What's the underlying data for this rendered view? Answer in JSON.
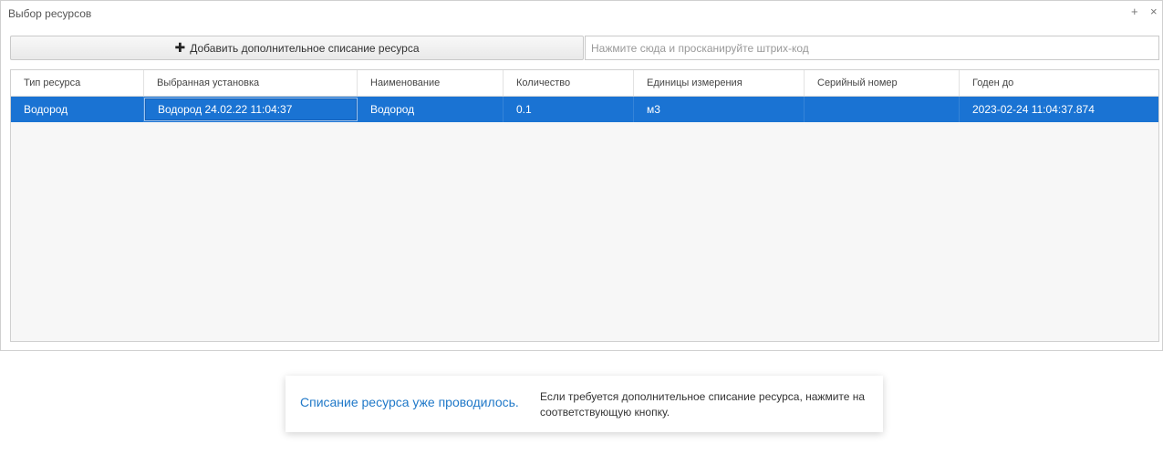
{
  "window": {
    "title": "Выбор ресурсов",
    "expand_icon": "plus-icon",
    "close_icon": "close-icon",
    "expand_glyph": "+",
    "close_glyph": "×"
  },
  "toolbar": {
    "add_button_icon": "plus-icon",
    "add_button_glyph": "✚",
    "add_button_label": "Добавить дополнительное списание ресурса",
    "barcode_placeholder": "Нажмите сюда и просканируйте штрих-код",
    "barcode_value": ""
  },
  "table": {
    "columns": [
      "Тип ресурса",
      "Выбранная установка",
      "Наименование",
      "Количество",
      "Единицы измерения",
      "Серийный номер",
      "Годен до"
    ],
    "rows": [
      [
        "Водород",
        "Водород 24.02.22 11:04:37",
        "Водород",
        "0.1",
        "м3",
        "",
        "2023-02-24 11:04:37.874"
      ]
    ],
    "selected_row": 0,
    "selection_color": "#1a73d3"
  },
  "notification": {
    "title": "Списание ресурса уже проводилось.",
    "message": "Если требуется дополнительное списание ресурса, нажмите на соответствующую кнопку.",
    "title_color": "#1f78c8"
  }
}
